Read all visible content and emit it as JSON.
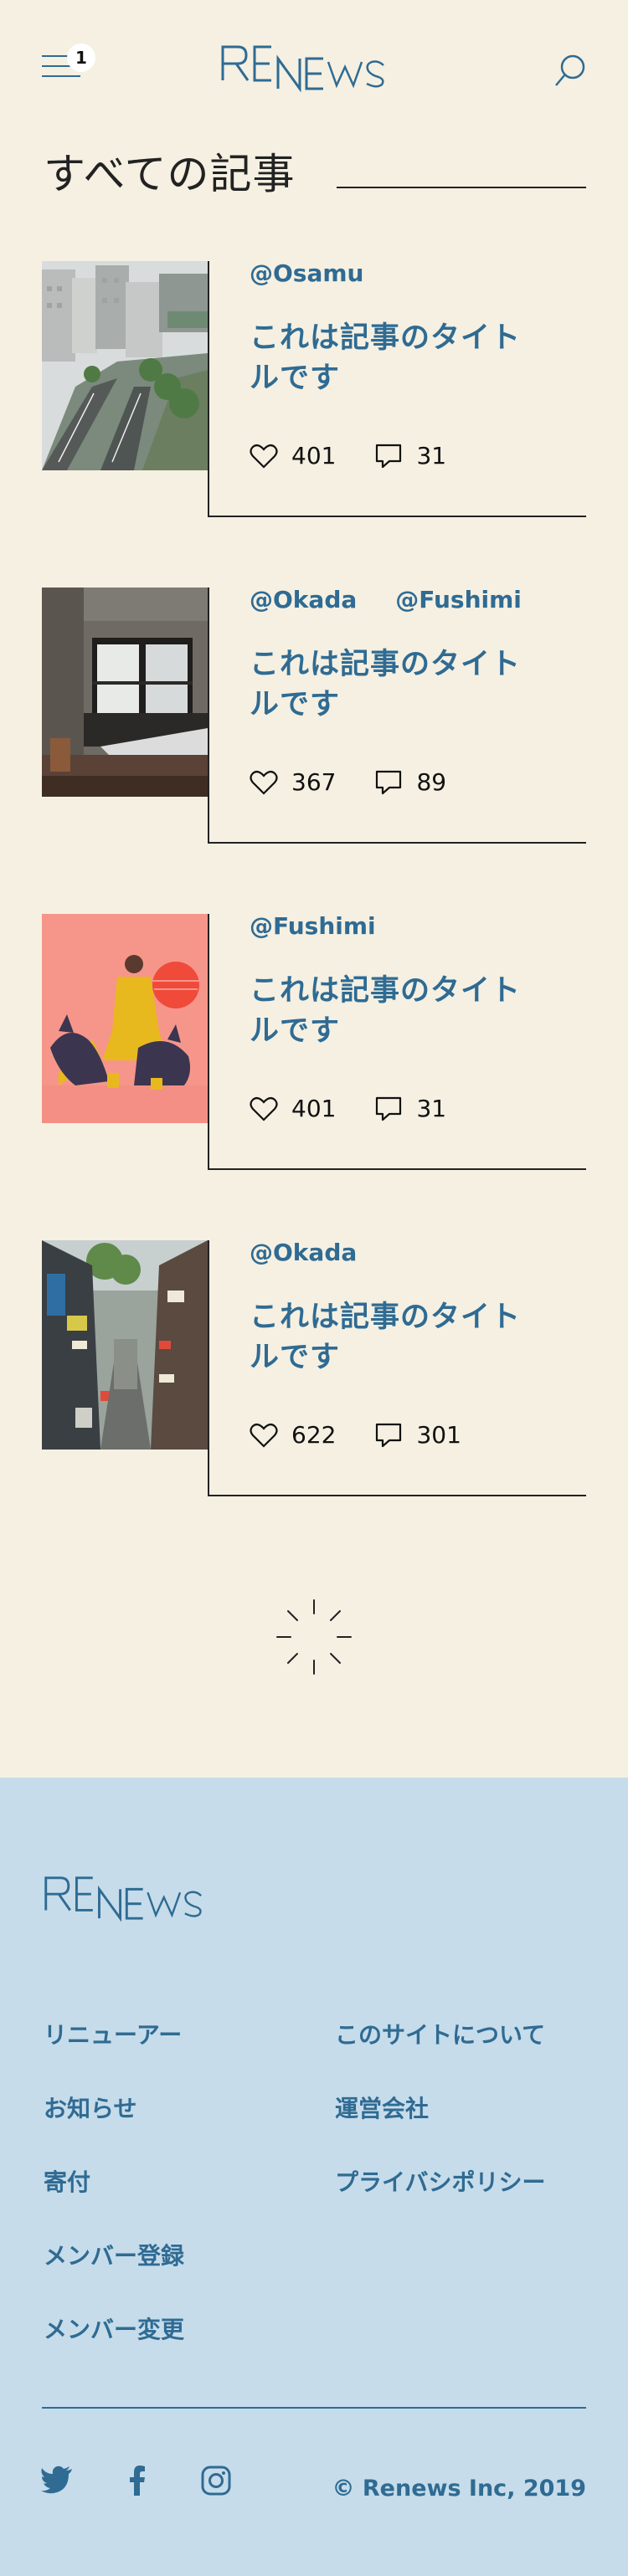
{
  "header": {
    "notification_count": "1",
    "logo_text": "RENEWS",
    "menu_icon": "hamburger-icon",
    "search_icon": "search-icon"
  },
  "section": {
    "title": "すべての記事"
  },
  "articles": [
    {
      "authors": [
        "@Osamu"
      ],
      "title": "これは記事のタイトルです",
      "likes": "401",
      "comments": "31",
      "image": "city-street-photo"
    },
    {
      "authors": [
        "@Okada",
        "@Fushimi"
      ],
      "title": "これは記事のタイトルです",
      "likes": "367",
      "comments": "89",
      "image": "room-interior-photo"
    },
    {
      "authors": [
        "@Fushimi"
      ],
      "title": "これは記事のタイトルです",
      "likes": "401",
      "comments": "31",
      "image": "illustration-woman-with-dogs"
    },
    {
      "authors": [
        "@Okada"
      ],
      "title": "これは記事のタイトルです",
      "likes": "622",
      "comments": "301",
      "image": "alley-photo"
    }
  ],
  "footer": {
    "logo_text": "RENEWS",
    "nav_left": [
      "リニューアー",
      "お知らせ",
      "寄付",
      "メンバー登録",
      "メンバー変更"
    ],
    "nav_right": [
      "このサイトについて",
      "運営会社",
      "プライバシポリシー"
    ],
    "social": [
      "twitter-icon",
      "facebook-icon",
      "instagram-icon"
    ],
    "copyright": "© Renews Inc, 2019"
  },
  "colors": {
    "background": "#f5f0e2",
    "accent": "#2f6b93",
    "footer_bg": "#c6dcea"
  }
}
